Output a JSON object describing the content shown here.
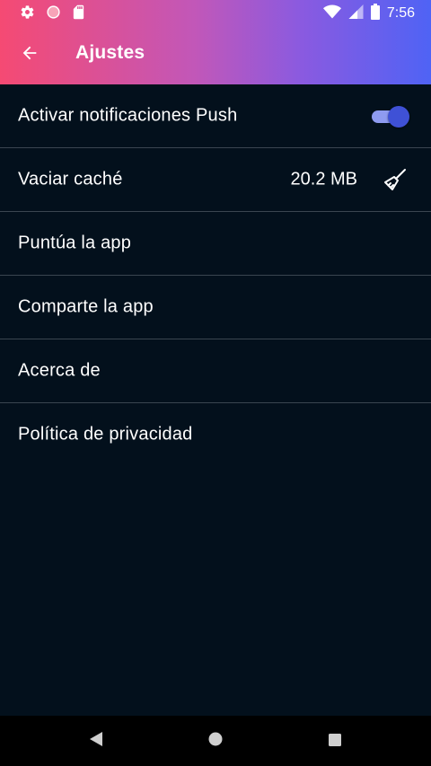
{
  "status_bar": {
    "time": "7:56",
    "icons": [
      "gear-icon",
      "circle-notification-icon",
      "sd-card-icon",
      "wifi-icon",
      "signal-icon",
      "battery-icon"
    ]
  },
  "toolbar": {
    "back_icon": "arrow-left-icon",
    "title": "Ajustes"
  },
  "colors": {
    "gradient_start": "#f54a73",
    "gradient_end": "#4f63f5",
    "background": "#03101c",
    "divider": "#3a4550",
    "toggle_thumb": "#3f51d6",
    "toggle_track": "#8e9bf0"
  },
  "settings": {
    "items": [
      {
        "label": "Activar notificaciones Push",
        "toggle_on": true
      },
      {
        "label": "Vaciar caché",
        "value": "20.2 MB",
        "icon": "broom-icon"
      },
      {
        "label": "Puntúa la app"
      },
      {
        "label": "Comparte la app"
      },
      {
        "label": "Acerca de"
      },
      {
        "label": "Política de privacidad"
      }
    ]
  },
  "nav_bar": {
    "icons": [
      "back-triangle-icon",
      "home-circle-icon",
      "recents-square-icon"
    ]
  }
}
